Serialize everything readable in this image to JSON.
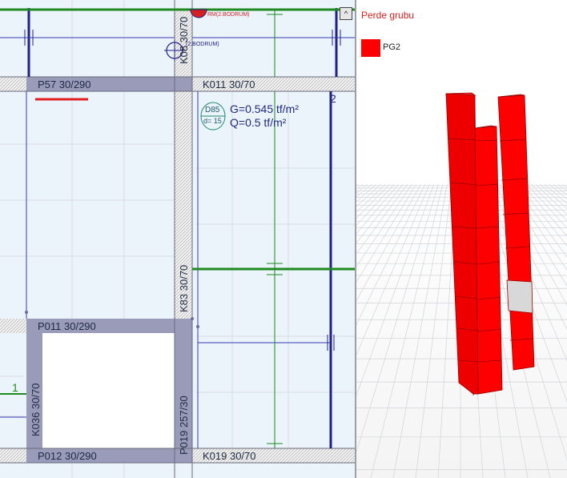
{
  "plan": {
    "beams": {
      "p57": "P57 30/290",
      "k011": "K011 30/70",
      "p011": "P011 30/290",
      "p012": "P012 30/290",
      "k019": "K019 30/70",
      "k08": "K08 30/70",
      "k83": "K83 30/70",
      "k036": "K036 30/70",
      "p019": "P019 257/30"
    },
    "slab": {
      "id": "D85",
      "thickness": "d= 15",
      "g_load": "G=0.545 tf/m²",
      "q_load": "Q=0.5 tf/m²"
    },
    "markers": {
      "rm_label": "RM(2.BODRUM)",
      "x_label": "(2.BODRUM)",
      "axis_2": "2",
      "axis_1": "1"
    },
    "collapse_glyph": "^"
  },
  "view3d": {
    "title": "Perde grubu",
    "legend_label": "PG2",
    "legend_color": "#ff0000"
  },
  "colors": {
    "plan_bg": "#ebf3fb",
    "beam_fill": "#9a9bb9",
    "axis_green": "#1f8a1f",
    "dim_blue": "#20208a",
    "wall_red": "#ff0000",
    "grid_gray": "#d8dde2"
  }
}
